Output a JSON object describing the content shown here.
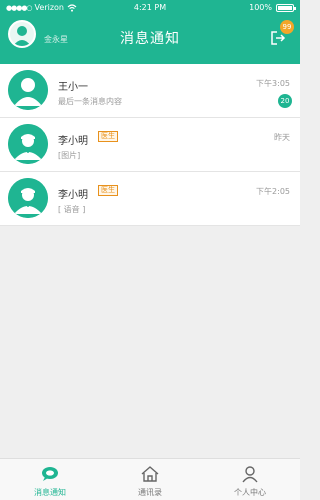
{
  "statusbar": {
    "carrier": "Verizon",
    "time": "4:21 PM",
    "battery": "100%"
  },
  "header": {
    "user_name": "金永星",
    "title": "消息通知",
    "badge": "99",
    "accent_color": "#1fb592"
  },
  "messages": [
    {
      "name": "王小一",
      "tag": "",
      "preview": "最后一条消息内容",
      "time": "下午3:05",
      "unread": "20"
    },
    {
      "name": "李小明",
      "tag": "医生",
      "preview": "[图片]",
      "time": "昨天",
      "unread": ""
    },
    {
      "name": "李小明",
      "tag": "医生",
      "preview": "[ 语音 ]",
      "time": "下午2:05",
      "unread": ""
    }
  ],
  "tabs": [
    {
      "label": "消息通知",
      "icon": "chat-icon",
      "active": true
    },
    {
      "label": "通讯录",
      "icon": "home-icon",
      "active": false
    },
    {
      "label": "个人中心",
      "icon": "person-icon",
      "active": false
    }
  ]
}
